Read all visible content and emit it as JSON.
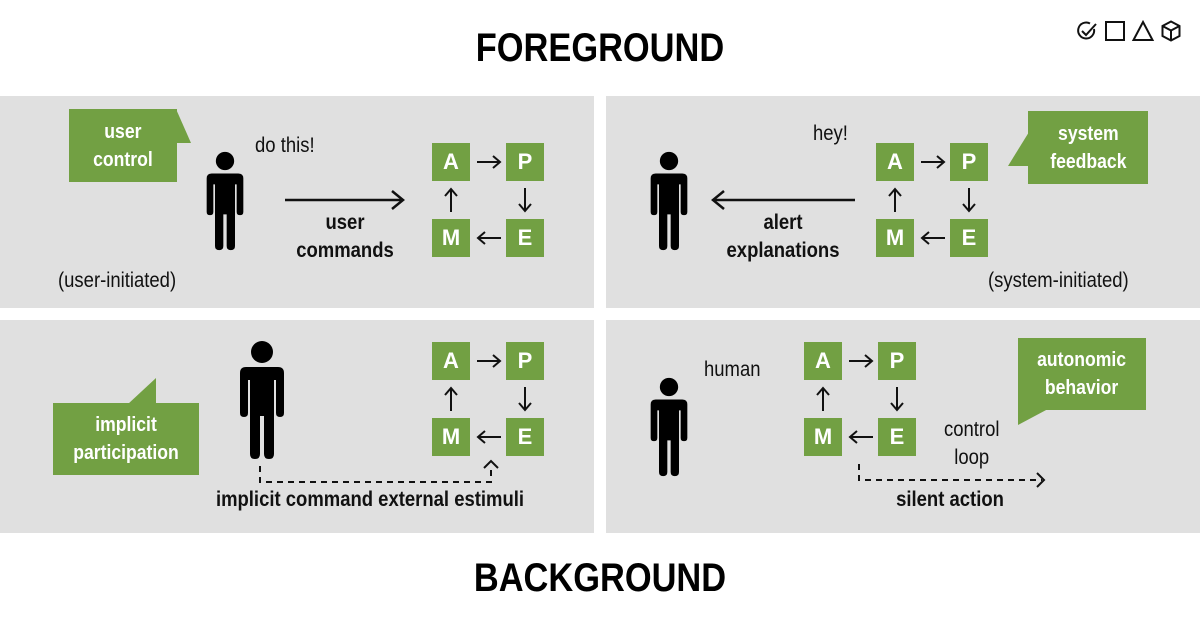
{
  "titles": {
    "foreground": "FOREGROUND",
    "background": "BACKGROUND"
  },
  "header_icons": [
    "check-circle-icon",
    "square-icon",
    "triangle-icon",
    "cube-icon"
  ],
  "colors": {
    "accent_green": "#72a043",
    "panel_gray": "#e0e0e0",
    "text": "#111111"
  },
  "loop": {
    "a": "A",
    "p": "P",
    "e": "E",
    "m": "M"
  },
  "panels": {
    "user_control": {
      "bubble": [
        "user",
        "control"
      ],
      "speech": "do this!",
      "arrow_label": [
        "user",
        "commands"
      ],
      "note": "(user-initiated)"
    },
    "system_feedback": {
      "bubble": [
        "system",
        "feedback"
      ],
      "speech": "hey!",
      "arrow_label": [
        "alert",
        "explanations"
      ],
      "note": "(system-initiated)"
    },
    "implicit_participation": {
      "bubble": [
        "implicit",
        "participation"
      ],
      "arrow_label": "implicit command external estimuli"
    },
    "autonomic_behavior": {
      "bubble": [
        "autonomic",
        "behavior"
      ],
      "human_label": "human",
      "loop_label": [
        "control",
        "loop"
      ],
      "arrow_label": "silent action"
    }
  }
}
